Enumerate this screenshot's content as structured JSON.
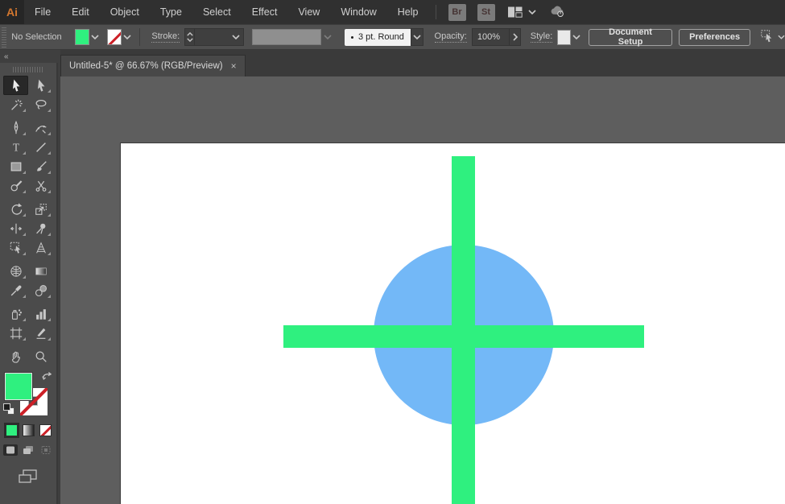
{
  "menubar": {
    "logo": "Ai",
    "items": [
      "File",
      "Edit",
      "Object",
      "Type",
      "Select",
      "Effect",
      "View",
      "Window",
      "Help"
    ],
    "bridge_button": "Br",
    "stock_button": "St"
  },
  "controlbar": {
    "selection_status": "No Selection",
    "stroke_label": "Stroke:",
    "brush_value": "3 pt. Round",
    "opacity_label": "Opacity:",
    "opacity_value": "100%",
    "style_label": "Style:",
    "document_setup_button": "Document Setup",
    "preferences_button": "Preferences"
  },
  "tabbar": {
    "tab_title": "Untitled-5* @ 66.67% (RGB/Preview)",
    "close_glyph": "×"
  },
  "dock": {
    "collapse_glyph": "«"
  },
  "tools": [
    "selection",
    "direct-selection",
    "magic-wand",
    "lasso",
    "pen",
    "curvature",
    "type",
    "line-segment",
    "rectangle",
    "paintbrush",
    "shaper",
    "scissors",
    "rotate",
    "scale",
    "width",
    "puppet-warp",
    "free-transform",
    "perspective-grid",
    "mesh",
    "gradient",
    "eyedropper",
    "blend",
    "symbol-sprayer",
    "column-graph",
    "artboard",
    "slice",
    "hand",
    "zoom"
  ],
  "colors": {
    "fill_green": "#2ff07f",
    "circle_blue": "#73b8f7",
    "slash_red": "#cc2027",
    "artboard_white": "#ffffff",
    "canvas_gray": "#5e5e5e",
    "style_swatch": "#e9e9e9"
  }
}
